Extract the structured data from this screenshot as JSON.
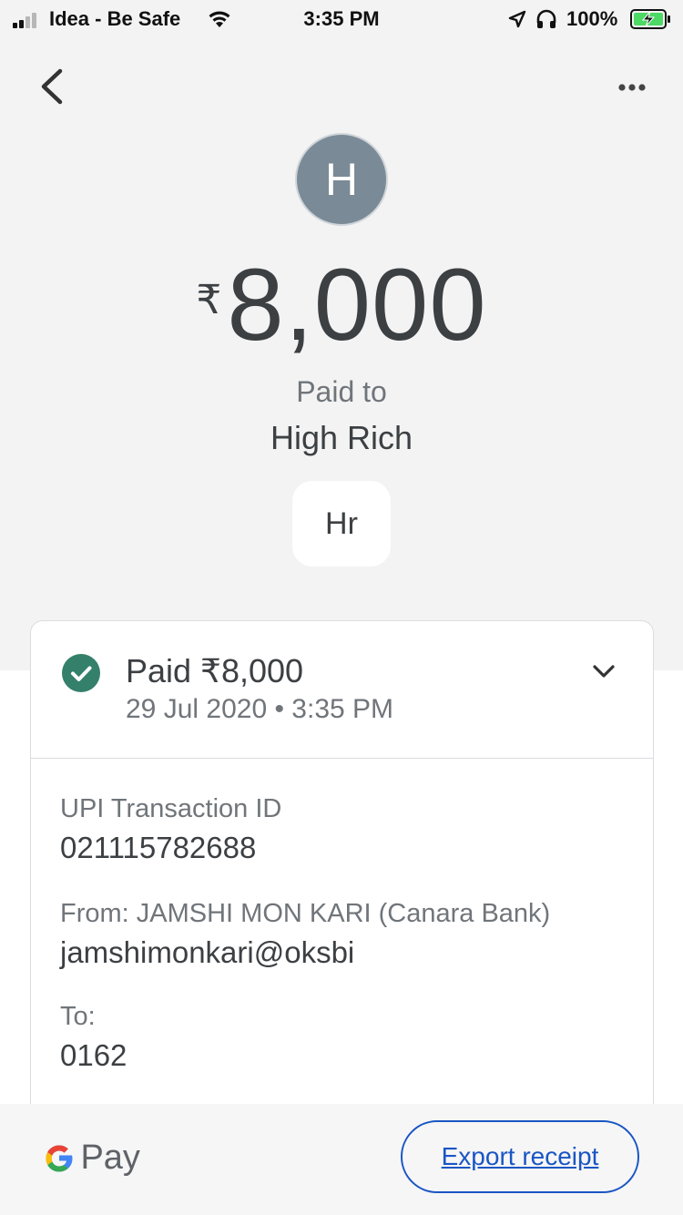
{
  "status_bar": {
    "carrier": "Idea - Be Safe",
    "time": "3:35 PM",
    "battery": "100%"
  },
  "header": {
    "avatar_letter": "H",
    "currency_symbol": "₹",
    "amount": "8,000",
    "paid_to_label": "Paid to",
    "payee_name": "High Rich",
    "payee_initials": "Hr"
  },
  "card": {
    "status": "Paid ₹8,000",
    "date_time": "29 Jul 2020 • 3:35 PM",
    "details": [
      {
        "label": "UPI Transaction ID",
        "value": "021115782688"
      },
      {
        "label": "From: JAMSHI MON KARI (Canara Bank)",
        "value": "jamshimonkari@oksbi"
      },
      {
        "label": "To:",
        "value": "0162"
      }
    ]
  },
  "footer": {
    "brand": "Pay",
    "export_label": "Export receipt"
  },
  "colors": {
    "accent": "#1a56c4",
    "success": "#34806a",
    "avatar_bg": "#7a8a96"
  }
}
